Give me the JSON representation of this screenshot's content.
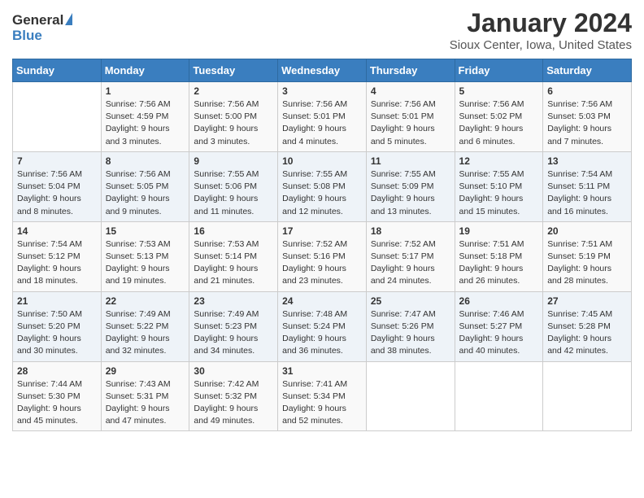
{
  "logo": {
    "general": "General",
    "blue": "Blue"
  },
  "title": "January 2024",
  "location": "Sioux Center, Iowa, United States",
  "days_of_week": [
    "Sunday",
    "Monday",
    "Tuesday",
    "Wednesday",
    "Thursday",
    "Friday",
    "Saturday"
  ],
  "weeks": [
    [
      {
        "day": "",
        "info": ""
      },
      {
        "day": "1",
        "info": "Sunrise: 7:56 AM\nSunset: 4:59 PM\nDaylight: 9 hours\nand 3 minutes."
      },
      {
        "day": "2",
        "info": "Sunrise: 7:56 AM\nSunset: 5:00 PM\nDaylight: 9 hours\nand 3 minutes."
      },
      {
        "day": "3",
        "info": "Sunrise: 7:56 AM\nSunset: 5:01 PM\nDaylight: 9 hours\nand 4 minutes."
      },
      {
        "day": "4",
        "info": "Sunrise: 7:56 AM\nSunset: 5:01 PM\nDaylight: 9 hours\nand 5 minutes."
      },
      {
        "day": "5",
        "info": "Sunrise: 7:56 AM\nSunset: 5:02 PM\nDaylight: 9 hours\nand 6 minutes."
      },
      {
        "day": "6",
        "info": "Sunrise: 7:56 AM\nSunset: 5:03 PM\nDaylight: 9 hours\nand 7 minutes."
      }
    ],
    [
      {
        "day": "7",
        "info": "Sunrise: 7:56 AM\nSunset: 5:04 PM\nDaylight: 9 hours\nand 8 minutes."
      },
      {
        "day": "8",
        "info": "Sunrise: 7:56 AM\nSunset: 5:05 PM\nDaylight: 9 hours\nand 9 minutes."
      },
      {
        "day": "9",
        "info": "Sunrise: 7:55 AM\nSunset: 5:06 PM\nDaylight: 9 hours\nand 11 minutes."
      },
      {
        "day": "10",
        "info": "Sunrise: 7:55 AM\nSunset: 5:08 PM\nDaylight: 9 hours\nand 12 minutes."
      },
      {
        "day": "11",
        "info": "Sunrise: 7:55 AM\nSunset: 5:09 PM\nDaylight: 9 hours\nand 13 minutes."
      },
      {
        "day": "12",
        "info": "Sunrise: 7:55 AM\nSunset: 5:10 PM\nDaylight: 9 hours\nand 15 minutes."
      },
      {
        "day": "13",
        "info": "Sunrise: 7:54 AM\nSunset: 5:11 PM\nDaylight: 9 hours\nand 16 minutes."
      }
    ],
    [
      {
        "day": "14",
        "info": "Sunrise: 7:54 AM\nSunset: 5:12 PM\nDaylight: 9 hours\nand 18 minutes."
      },
      {
        "day": "15",
        "info": "Sunrise: 7:53 AM\nSunset: 5:13 PM\nDaylight: 9 hours\nand 19 minutes."
      },
      {
        "day": "16",
        "info": "Sunrise: 7:53 AM\nSunset: 5:14 PM\nDaylight: 9 hours\nand 21 minutes."
      },
      {
        "day": "17",
        "info": "Sunrise: 7:52 AM\nSunset: 5:16 PM\nDaylight: 9 hours\nand 23 minutes."
      },
      {
        "day": "18",
        "info": "Sunrise: 7:52 AM\nSunset: 5:17 PM\nDaylight: 9 hours\nand 24 minutes."
      },
      {
        "day": "19",
        "info": "Sunrise: 7:51 AM\nSunset: 5:18 PM\nDaylight: 9 hours\nand 26 minutes."
      },
      {
        "day": "20",
        "info": "Sunrise: 7:51 AM\nSunset: 5:19 PM\nDaylight: 9 hours\nand 28 minutes."
      }
    ],
    [
      {
        "day": "21",
        "info": "Sunrise: 7:50 AM\nSunset: 5:20 PM\nDaylight: 9 hours\nand 30 minutes."
      },
      {
        "day": "22",
        "info": "Sunrise: 7:49 AM\nSunset: 5:22 PM\nDaylight: 9 hours\nand 32 minutes."
      },
      {
        "day": "23",
        "info": "Sunrise: 7:49 AM\nSunset: 5:23 PM\nDaylight: 9 hours\nand 34 minutes."
      },
      {
        "day": "24",
        "info": "Sunrise: 7:48 AM\nSunset: 5:24 PM\nDaylight: 9 hours\nand 36 minutes."
      },
      {
        "day": "25",
        "info": "Sunrise: 7:47 AM\nSunset: 5:26 PM\nDaylight: 9 hours\nand 38 minutes."
      },
      {
        "day": "26",
        "info": "Sunrise: 7:46 AM\nSunset: 5:27 PM\nDaylight: 9 hours\nand 40 minutes."
      },
      {
        "day": "27",
        "info": "Sunrise: 7:45 AM\nSunset: 5:28 PM\nDaylight: 9 hours\nand 42 minutes."
      }
    ],
    [
      {
        "day": "28",
        "info": "Sunrise: 7:44 AM\nSunset: 5:30 PM\nDaylight: 9 hours\nand 45 minutes."
      },
      {
        "day": "29",
        "info": "Sunrise: 7:43 AM\nSunset: 5:31 PM\nDaylight: 9 hours\nand 47 minutes."
      },
      {
        "day": "30",
        "info": "Sunrise: 7:42 AM\nSunset: 5:32 PM\nDaylight: 9 hours\nand 49 minutes."
      },
      {
        "day": "31",
        "info": "Sunrise: 7:41 AM\nSunset: 5:34 PM\nDaylight: 9 hours\nand 52 minutes."
      },
      {
        "day": "",
        "info": ""
      },
      {
        "day": "",
        "info": ""
      },
      {
        "day": "",
        "info": ""
      }
    ]
  ]
}
